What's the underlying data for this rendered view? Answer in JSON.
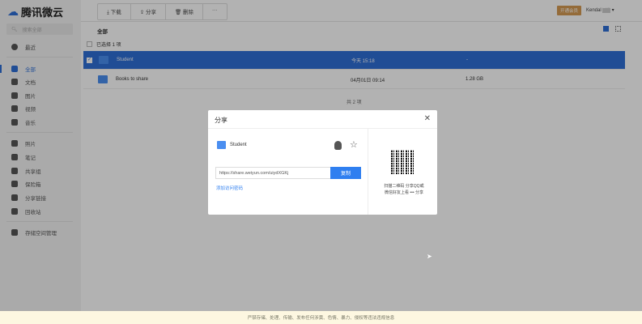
{
  "app": {
    "title": "腾讯微云"
  },
  "sidebar": {
    "search_placeholder": "搜索全部",
    "recent": "最近",
    "items": [
      {
        "label": "全部",
        "icon": "all-icon",
        "active": true
      },
      {
        "label": "文档",
        "icon": "document-icon"
      },
      {
        "label": "图片",
        "icon": "image-icon"
      },
      {
        "label": "视频",
        "icon": "video-icon"
      },
      {
        "label": "音乐",
        "icon": "music-icon"
      }
    ],
    "tools": [
      {
        "label": "照片",
        "icon": "photo-icon"
      },
      {
        "label": "笔记",
        "icon": "note-icon"
      },
      {
        "label": "共享组",
        "icon": "group-icon"
      },
      {
        "label": "保险箱",
        "icon": "safe-icon"
      },
      {
        "label": "分享链接",
        "icon": "share-link-icon"
      },
      {
        "label": "回收站",
        "icon": "trash-icon"
      }
    ],
    "storage": "存储空间管理"
  },
  "toolbar": {
    "download": "下载",
    "share": "分享",
    "delete": "删除",
    "more": "···"
  },
  "header": {
    "vip": "开通会员",
    "user": "Kendal"
  },
  "main": {
    "breadcrumb": "全部",
    "selected": "已选择 1 项",
    "total": "共 2 项",
    "files": [
      {
        "name": "Student",
        "date": "今天 15:18",
        "size": "-",
        "selected": true
      },
      {
        "name": "Books to share",
        "date": "04月01日 09:14",
        "size": "1.28 GB",
        "selected": false
      }
    ]
  },
  "dialog": {
    "title": "分享",
    "file": "Student",
    "url": "https://share.weiyun.com/uiydXGKj",
    "copy": "复制",
    "add_password": "添加访问密码",
    "qr_text_1": "扫描二维码 分享QQ或",
    "qr_text_2": "微信好友上看 ••• 分享"
  },
  "footer": {
    "notice": "严禁存储、处理、传输、发布任何涉黄、色情、暴力、侵权等违法违规信息"
  },
  "colors": {
    "accent": "#2f6fd6",
    "vip": "#d49a52"
  }
}
